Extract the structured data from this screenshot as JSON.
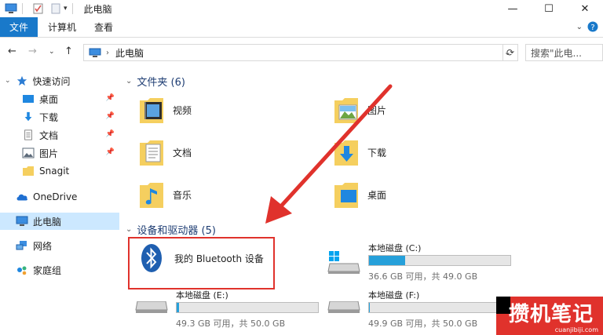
{
  "window": {
    "title": "此电脑"
  },
  "ribbon": {
    "tabs": [
      "文件",
      "计算机",
      "查看"
    ]
  },
  "address": {
    "path": "此电脑",
    "search_placeholder": "搜索\"此电..."
  },
  "nav": {
    "quick_access": "快速访问",
    "items": [
      {
        "label": "桌面",
        "icon": "desktop-icon",
        "pinned": true
      },
      {
        "label": "下载",
        "icon": "download-icon",
        "pinned": true
      },
      {
        "label": "文档",
        "icon": "document-icon",
        "pinned": true
      },
      {
        "label": "图片",
        "icon": "picture-icon",
        "pinned": true
      },
      {
        "label": "Snagit",
        "icon": "folder-icon",
        "pinned": false
      }
    ],
    "onedrive": "OneDrive",
    "this_pc": "此电脑",
    "network": "网络",
    "homegroup": "家庭组"
  },
  "folders_group": {
    "title": "文件夹 (6)"
  },
  "folders": [
    {
      "name": "视频",
      "icon": "video-folder-icon"
    },
    {
      "name": "图片",
      "icon": "picture-folder-icon"
    },
    {
      "name": "文档",
      "icon": "document-folder-icon"
    },
    {
      "name": "下载",
      "icon": "download-folder-icon"
    },
    {
      "name": "音乐",
      "icon": "music-folder-icon"
    },
    {
      "name": "桌面",
      "icon": "desktop-folder-icon"
    }
  ],
  "devices_group": {
    "title": "设备和驱动器 (5)"
  },
  "bluetooth": {
    "label": "我的 Bluetooth 设备"
  },
  "drives": [
    {
      "name": "本地磁盘 (C:)",
      "info": "36.6 GB 可用，共 49.0 GB",
      "used_fraction": 0.253
    },
    {
      "name": "本地磁盘 (E:)",
      "info": "49.3 GB 可用，共 50.0 GB",
      "used_fraction": 0.014
    },
    {
      "name": "本地磁盘 (F:)",
      "info": "49.9 GB 可用，共 50.0 GB",
      "used_fraction": 0.002
    }
  ],
  "watermark": {
    "text": "攒机笔记",
    "url": "cuanjibiji.com"
  },
  "colors": {
    "accent": "#1979ca",
    "selection": "#cce8ff",
    "annotation": "#e0322c",
    "bar_fill": "#26a0da"
  }
}
